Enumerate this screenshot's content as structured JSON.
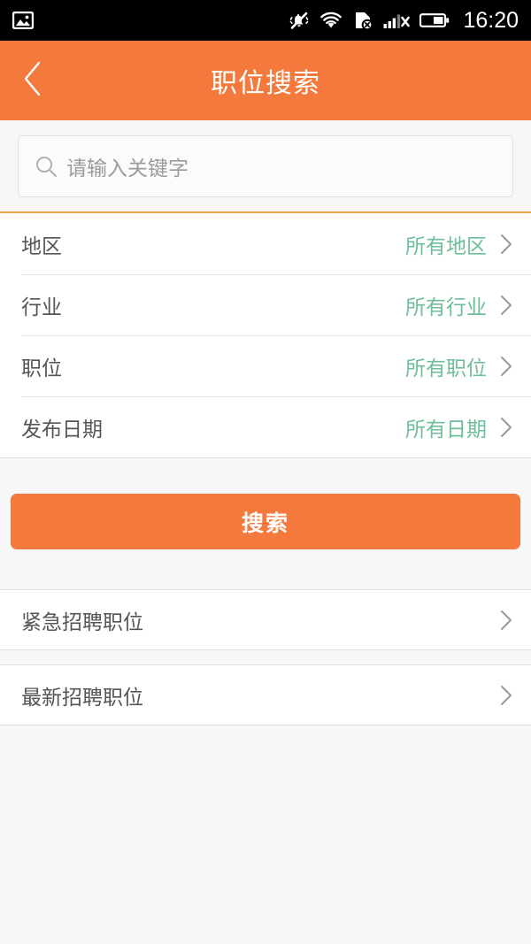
{
  "statusbar": {
    "time": "16:20",
    "left_icons": [
      {
        "name": "gallery-icon"
      }
    ],
    "right_icons": [
      {
        "name": "vibrate-mute-icon"
      },
      {
        "name": "wifi-icon"
      },
      {
        "name": "sim-disabled-icon"
      },
      {
        "name": "signal-no-service-icon"
      },
      {
        "name": "battery-icon"
      }
    ]
  },
  "header": {
    "title": "职位搜索",
    "back_icon": "back-chevron-icon",
    "background": "#f4793c"
  },
  "search": {
    "placeholder": "请输入关键字",
    "value": "",
    "icon": "search-icon"
  },
  "filters": [
    {
      "label": "地区",
      "value": "所有地区"
    },
    {
      "label": "行业",
      "value": "所有行业"
    },
    {
      "label": "职位",
      "value": "所有职位"
    },
    {
      "label": "发布日期",
      "value": "所有日期"
    }
  ],
  "button": {
    "search_label": "搜索"
  },
  "links": [
    {
      "label": "紧急招聘职位"
    },
    {
      "label": "最新招聘职位"
    }
  ],
  "colors": {
    "accent_orange": "#f4793c",
    "value_green": "#6ebf99",
    "page_background": "#f7f7f7",
    "text_primary": "#555555",
    "placeholder": "#9b9b9b"
  }
}
